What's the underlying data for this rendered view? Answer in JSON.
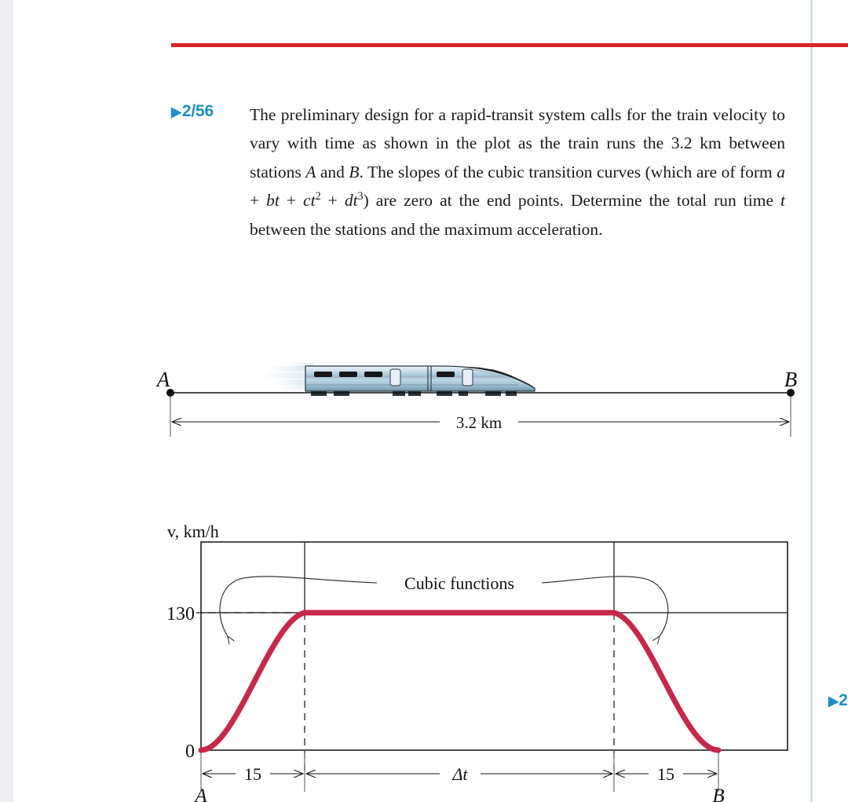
{
  "page": {
    "left_strip_color": "#eeedf3",
    "rule_color": "#d8232a",
    "accent_color": "#1d8fc4",
    "curve_color": "#c8274c",
    "right_divider_color": "#cfe3e8"
  },
  "problem": {
    "number": "2/56",
    "marker": "▶",
    "text_html": "The preliminary design for a rapid-transit system calls for the train velocity to vary with time as shown in the plot as the train runs the 3.2 km between stations <i>A</i> and <i>B</i>. The slopes of the cubic transition curves (which are of form <i>a</i> + <i>bt</i> + <i>ct</i><sup>2</sup> + <i>dt</i><sup>3</sup>) are zero at the end points. Determine the total run time <i>t</i> between the stations and the maximum acceleration.",
    "text_plain": "The preliminary design for a rapid-transit system calls for the train velocity to vary with time as shown in the plot as the train runs the 3.2 km between stations A and B. The slopes of the cubic transition curves (which are of form a + bt + ct2 + dt3) are zero at the end points. Determine the total run time t between the stations and the maximum acceleration."
  },
  "track_figure": {
    "station_a_label": "A",
    "station_b_label": "B",
    "distance_label": "3.2 km",
    "vehicle": "high-speed-train"
  },
  "next_problem": {
    "marker": "▶",
    "number": "2"
  },
  "chart_data": {
    "type": "line",
    "title": "",
    "ylabel": "v, km/h",
    "xlabel": "",
    "y_ticks": [
      "0",
      "130"
    ],
    "y_tick_values": [
      0,
      130
    ],
    "ylim": [
      0,
      186
    ],
    "x_segment_labels": [
      "15",
      "Δt",
      "15"
    ],
    "x_endpoint_labels": [
      "A",
      "B"
    ],
    "annotation": "Cubic functions",
    "plateau_value": 130,
    "ramp_up_duration": 15,
    "ramp_down_duration": 15,
    "cruise_duration_label": "Δt",
    "grid": false,
    "legend": null,
    "series": [
      {
        "name": "train velocity",
        "description": "cubic ramp up 0 to 130 over 15 s, constant 130 for Δt, cubic ramp down 130 to 0 over 15 s",
        "x": [
          0,
          3.75,
          7.5,
          11.25,
          15,
          45,
          60,
          63.75,
          67.5,
          71.25,
          75
        ],
        "y": [
          0,
          20.3,
          65,
          109.7,
          130,
          130,
          130,
          109.7,
          65,
          20.3,
          0
        ]
      }
    ]
  }
}
